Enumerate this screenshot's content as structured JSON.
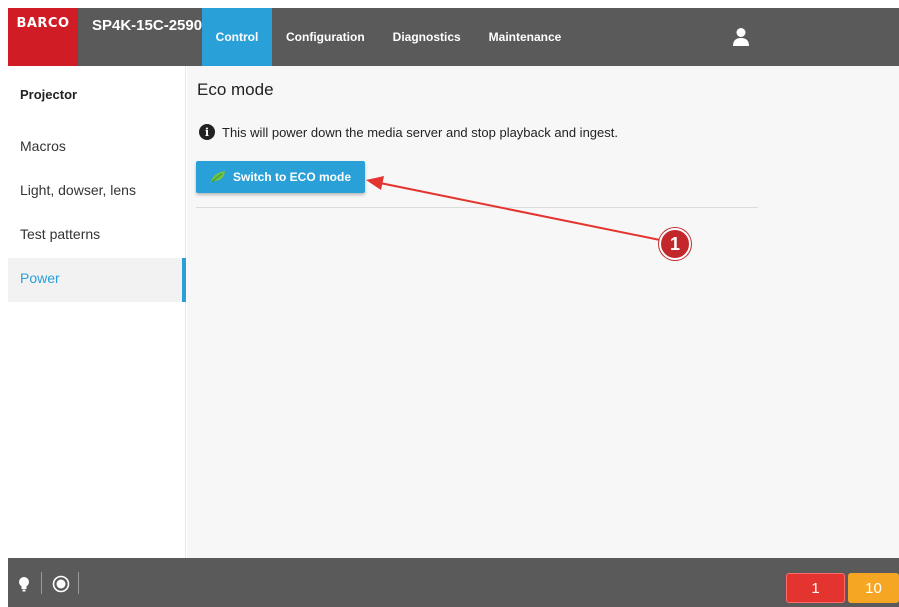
{
  "header": {
    "logo": "BARCO",
    "device_name": "SP4K-15C-2590",
    "tabs": [
      {
        "label": "Control",
        "active": true
      },
      {
        "label": "Configuration",
        "active": false
      },
      {
        "label": "Diagnostics",
        "active": false
      },
      {
        "label": "Maintenance",
        "active": false
      }
    ],
    "user_icon": "user-icon"
  },
  "sidebar": {
    "title": "Projector",
    "items": [
      {
        "label": "Macros",
        "active": false
      },
      {
        "label": "Light, dowser, lens",
        "active": false
      },
      {
        "label": "Test patterns",
        "active": false
      },
      {
        "label": "Power",
        "active": true
      }
    ]
  },
  "main": {
    "title": "Eco mode",
    "info_text": "This will power down the media server and stop playback and ingest.",
    "eco_button_label": "Switch to ECO mode"
  },
  "annotation": {
    "callout_number": "1"
  },
  "footer": {
    "error_count": "1",
    "warning_count": "10"
  },
  "colors": {
    "accent": "#2aa0d8",
    "brand": "#d01c24",
    "bar": "#5a5a5a",
    "error": "#e3342f",
    "warning": "#f5a623",
    "callout": "#c3272b"
  }
}
